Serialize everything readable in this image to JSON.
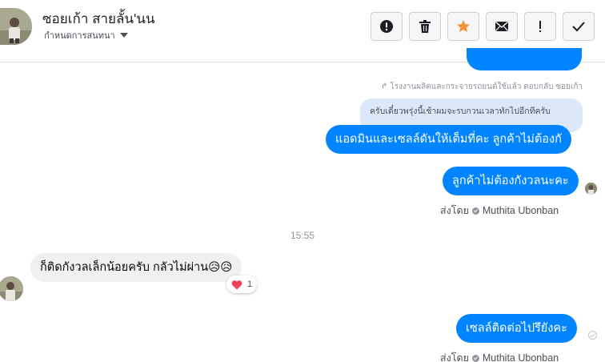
{
  "header": {
    "contact_name": "ซอยเก้า สายลั้น'นน",
    "conversation_settings": "กำหนดการสนทนา",
    "actions": [
      {
        "name": "mark-spam-button",
        "icon": "exclamation-circle-icon"
      },
      {
        "name": "delete-button",
        "icon": "trash-icon"
      },
      {
        "name": "star-button",
        "icon": "star-icon",
        "color": "#f7923b"
      },
      {
        "name": "mark-unread-button",
        "icon": "envelope-icon"
      },
      {
        "name": "follow-up-button",
        "icon": "exclamation-icon"
      },
      {
        "name": "mark-done-button",
        "icon": "check-icon"
      }
    ]
  },
  "thread": {
    "reply_note": "โรงงานผลิตและกระจายรถยนต์ใช้แล้ว ตอบกลับ ซอยเก้า",
    "reply_quote": "ครับเดี๋ยวพรุ่งนี้เช้าผมจะรบกวนเวลาทักไปอีกทีครับ",
    "messages": [
      {
        "text": "แอดมินและเซลล์ดันให้เต็มที่คะ ลูกค้าไม่ต้องกั"
      },
      {
        "text": "ลูกค้าไม่ต้องกังวลนะคะ"
      },
      {
        "text": "ก็ติดกังวลเล็กน้อยครับ กลัวไม่ผ่าน😥😥"
      },
      {
        "text": "เซลล์ติดต่อไปรึยังคะ"
      }
    ],
    "sent_by_label": "ส่งโดย",
    "agent_name": "Muthita Ubonban",
    "time_separator": "15:55",
    "reaction_count": "1"
  },
  "colors": {
    "outgoing_bubble": "#0084ff",
    "incoming_bubble": "#f1f0f0",
    "star": "#f7923b"
  }
}
